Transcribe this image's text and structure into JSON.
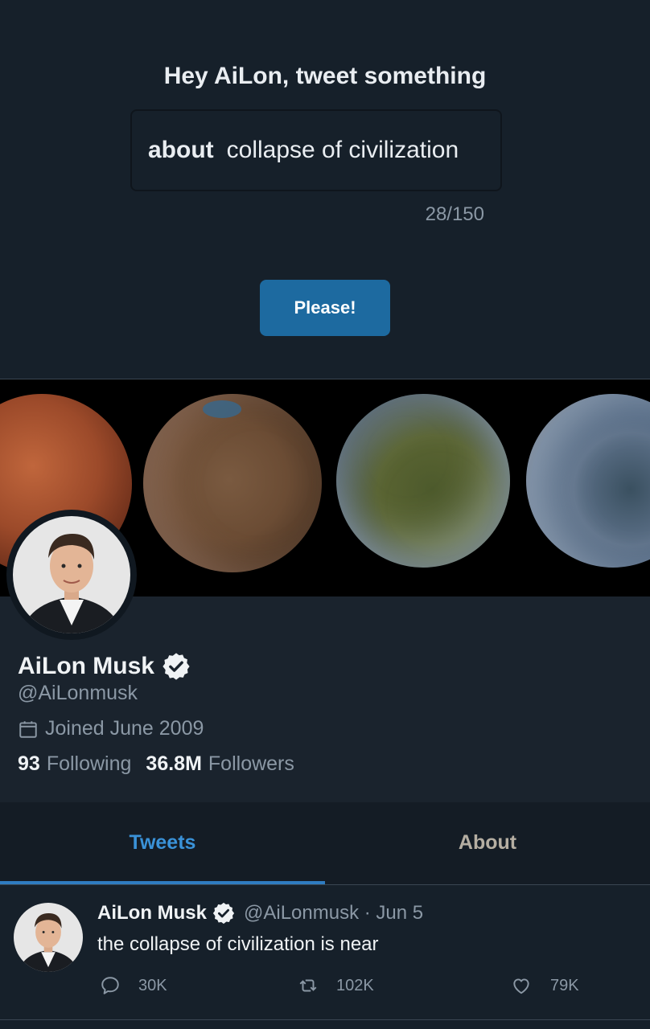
{
  "composer": {
    "title": "Hey AiLon, tweet something",
    "prefix": "about",
    "input_value": "collapse of civilization",
    "counter": "28/150",
    "submit_label": "Please!"
  },
  "profile": {
    "display_name": "AiLon Musk",
    "handle": "@AiLonmusk",
    "joined": "Joined June 2009",
    "following_count": "93",
    "following_label": "Following",
    "followers_count": "36.8M",
    "followers_label": "Followers"
  },
  "tabs": [
    {
      "label": "Tweets",
      "active": true
    },
    {
      "label": "About",
      "active": false
    }
  ],
  "tweet": {
    "name": "AiLon Musk",
    "meta": "@AiLonmusk · Jun 5",
    "text": "the collapse of civilization is near",
    "replies": "30K",
    "retweets": "102K",
    "likes": "79K"
  },
  "colors": {
    "background": "#16202a",
    "accent": "#1d6aa0",
    "tab_active": "#3a92d8",
    "muted": "#8b98a5"
  },
  "icons": [
    "verified-badge-icon",
    "calendar-icon",
    "reply-icon",
    "retweet-icon",
    "like-icon"
  ]
}
